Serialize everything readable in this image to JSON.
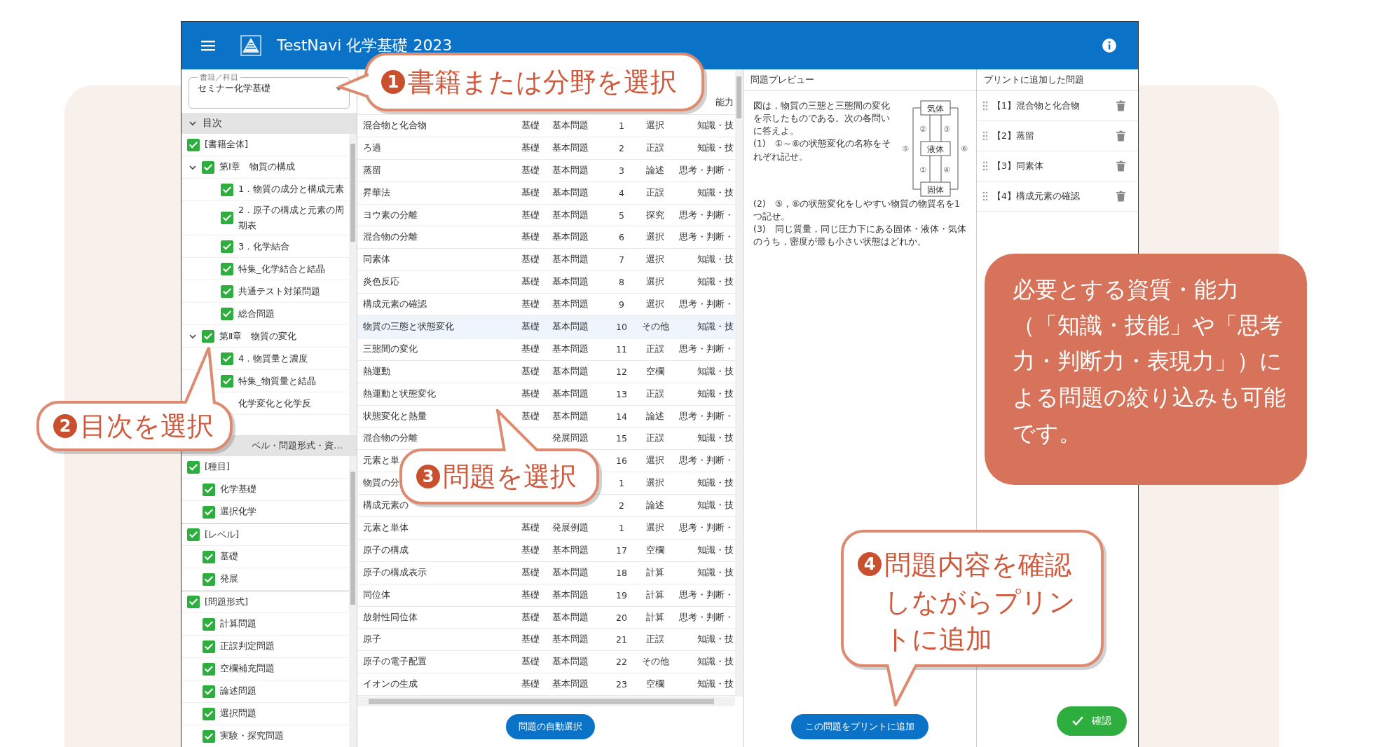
{
  "window": {
    "title": "TestNavi 化学基礎 2023"
  },
  "book_select": {
    "label": "書籍／科目",
    "value": "セミナー化学基礎"
  },
  "toc": {
    "title": "目次",
    "expanded": true,
    "tree": [
      {
        "label": "[書籍全体]",
        "checked": true,
        "children": [
          {
            "label": "第Ⅰ章　物質の構成",
            "checked": true,
            "expanded": true,
            "children": [
              {
                "label": "1．物質の成分と構成元素",
                "checked": true
              },
              {
                "label": "2．原子の構成と元素の周期表",
                "checked": true
              },
              {
                "label": "3．化学結合",
                "checked": true
              },
              {
                "label": "特集_化学結合と結晶",
                "checked": true
              },
              {
                "label": "共通テスト対策問題",
                "checked": true
              },
              {
                "label": "総合問題",
                "checked": true
              }
            ]
          },
          {
            "label": "第Ⅱ章　物質の変化",
            "checked": true,
            "expanded": true,
            "children": [
              {
                "label": "4．物質量と濃度",
                "checked": true
              },
              {
                "label": "特集_物質量と結晶",
                "checked": true
              },
              {
                "label": "化学変化と化学反"
              }
            ]
          }
        ]
      }
    ]
  },
  "filters": {
    "title": "ベル・問題形式・資…",
    "groups": [
      {
        "label": "[種目]",
        "checked": true,
        "items": [
          {
            "label": "化学基礎",
            "checked": true
          },
          {
            "label": "選択化学",
            "checked": true
          }
        ]
      },
      {
        "label": "[レベル]",
        "checked": true,
        "items": [
          {
            "label": "基礎",
            "checked": true
          },
          {
            "label": "発展",
            "checked": true
          }
        ]
      },
      {
        "label": "[問題形式]",
        "checked": true,
        "items": [
          {
            "label": "計算問題",
            "checked": true
          },
          {
            "label": "正誤判定問題",
            "checked": true
          },
          {
            "label": "空欄補充問題",
            "checked": true
          },
          {
            "label": "論述問題",
            "checked": true
          },
          {
            "label": "選択問題",
            "checked": true
          },
          {
            "label": "実験・探究問題",
            "checked": true
          }
        ]
      }
    ]
  },
  "table": {
    "header_last": "能力",
    "rows": [
      {
        "name": "混合物と化合物",
        "level": "基礎",
        "type": "基本問題",
        "no": "1",
        "format": "選択",
        "ability": "知識・技",
        "selected": false
      },
      {
        "name": "ろ過",
        "level": "基礎",
        "type": "基本問題",
        "no": "2",
        "format": "正誤",
        "ability": "知識・技",
        "selected": false
      },
      {
        "name": "蒸留",
        "level": "基礎",
        "type": "基本問題",
        "no": "3",
        "format": "論述",
        "ability": "思考・判断・",
        "selected": false
      },
      {
        "name": "昇華法",
        "level": "基礎",
        "type": "基本問題",
        "no": "4",
        "format": "正誤",
        "ability": "知識・技",
        "selected": false
      },
      {
        "name": "ヨウ素の分離",
        "level": "基礎",
        "type": "基本問題",
        "no": "5",
        "format": "探究",
        "ability": "思考・判断・",
        "selected": false
      },
      {
        "name": "混合物の分離",
        "level": "基礎",
        "type": "基本問題",
        "no": "6",
        "format": "選択",
        "ability": "思考・判断・",
        "selected": false
      },
      {
        "name": "同素体",
        "level": "基礎",
        "type": "基本問題",
        "no": "7",
        "format": "選択",
        "ability": "知識・技",
        "selected": false
      },
      {
        "name": "炎色反応",
        "level": "基礎",
        "type": "基本問題",
        "no": "8",
        "format": "選択",
        "ability": "知識・技",
        "selected": false
      },
      {
        "name": "構成元素の確認",
        "level": "基礎",
        "type": "基本問題",
        "no": "9",
        "format": "選択",
        "ability": "思考・判断・",
        "selected": false
      },
      {
        "name": "物質の三態と状態変化",
        "level": "基礎",
        "type": "基本問題",
        "no": "10",
        "format": "その他",
        "ability": "知識・技",
        "selected": true
      },
      {
        "name": "三態間の変化",
        "level": "基礎",
        "type": "基本問題",
        "no": "11",
        "format": "正誤",
        "ability": "思考・判断・",
        "selected": false
      },
      {
        "name": "熱運動",
        "level": "基礎",
        "type": "基本問題",
        "no": "12",
        "format": "空欄",
        "ability": "知識・技",
        "selected": false
      },
      {
        "name": "熱運動と状態変化",
        "level": "基礎",
        "type": "基本問題",
        "no": "13",
        "format": "正誤",
        "ability": "知識・技",
        "selected": false
      },
      {
        "name": "状態変化と熱量",
        "level": "基礎",
        "type": "基本問題",
        "no": "14",
        "format": "論述",
        "ability": "思考・判断・",
        "selected": false
      },
      {
        "name": "混合物の分離",
        "type": "発展問題",
        "no": "15",
        "format": "正誤",
        "ability": "知識・技",
        "selected": false
      },
      {
        "name": "元素と単",
        "no": "16",
        "format": "選択",
        "ability": "思考・判断・",
        "selected": false
      },
      {
        "name": "物質の分",
        "no": "1",
        "format": "選択",
        "ability": "知識・技",
        "selected": false
      },
      {
        "name": "構成元素の",
        "no": "2",
        "format": "論述",
        "ability": "知識・技",
        "selected": false
      },
      {
        "name": "元素と単体",
        "level": "基礎",
        "type": "発展例題",
        "no": "1",
        "format": "選択",
        "ability": "思考・判断・",
        "selected": false
      },
      {
        "name": "原子の構成",
        "level": "基礎",
        "type": "基本問題",
        "no": "17",
        "format": "空欄",
        "ability": "知識・技",
        "selected": false
      },
      {
        "name": "原子の構成表示",
        "level": "基礎",
        "type": "基本問題",
        "no": "18",
        "format": "計算",
        "ability": "知識・技",
        "selected": false
      },
      {
        "name": "同位体",
        "level": "基礎",
        "type": "基本問題",
        "no": "19",
        "format": "計算",
        "ability": "思考・判断・",
        "selected": false
      },
      {
        "name": "放射性同位体",
        "level": "基礎",
        "type": "基本問題",
        "no": "20",
        "format": "計算",
        "ability": "思考・判断・",
        "selected": false
      },
      {
        "name": "原子",
        "level": "基礎",
        "type": "基本問題",
        "no": "21",
        "format": "正誤",
        "ability": "知識・技",
        "selected": false
      },
      {
        "name": "原子の電子配置",
        "level": "基礎",
        "type": "基本問題",
        "no": "22",
        "format": "その他",
        "ability": "知識・技",
        "selected": false
      },
      {
        "name": "イオンの生成",
        "level": "基礎",
        "type": "基本問題",
        "no": "23",
        "format": "空欄",
        "ability": "知識・技",
        "selected": false
      }
    ],
    "auto_button": "問題の自動選択"
  },
  "preview": {
    "title": "問題プレビュー",
    "paragraphs": [
      "図は，物質の三態と三態間の変化を示したものである。次の各問いに答えよ。",
      "(1)　①～⑥の状態変化の名称をそれぞれ記せ。",
      "(2)　⑤，⑥の状態変化をしやすい物質の物質名を1つ記せ。",
      "(3)　同じ質量，同じ圧力下にある固体・液体・気体のうち，密度が最も小さい状態はどれか。"
    ],
    "diagram": {
      "states": [
        "気体",
        "液体",
        "固体"
      ],
      "marks": [
        "②",
        "③",
        "①",
        "④",
        "⑤",
        "⑥"
      ]
    },
    "add_button": "この問題をプリントに追加"
  },
  "print_list": {
    "title": "プリントに追加した問題",
    "items": [
      "【1】混合物と化合物",
      "【2】蒸留",
      "【3】同素体",
      "【4】構成元素の確認"
    ],
    "confirm_button": "確認"
  },
  "callouts": [
    {
      "number": "1",
      "text": "書籍または分野を選択"
    },
    {
      "number": "2",
      "text": "目次を選択"
    },
    {
      "number": "3",
      "text": "問題を選択"
    },
    {
      "number": "4",
      "text": "問題内容を確認しながらプリントに追加"
    }
  ],
  "note": "必要とする資質・能力（「知識・技能」や「思考力・判断力・表現力」）による問題の絞り込みも可能です。"
}
